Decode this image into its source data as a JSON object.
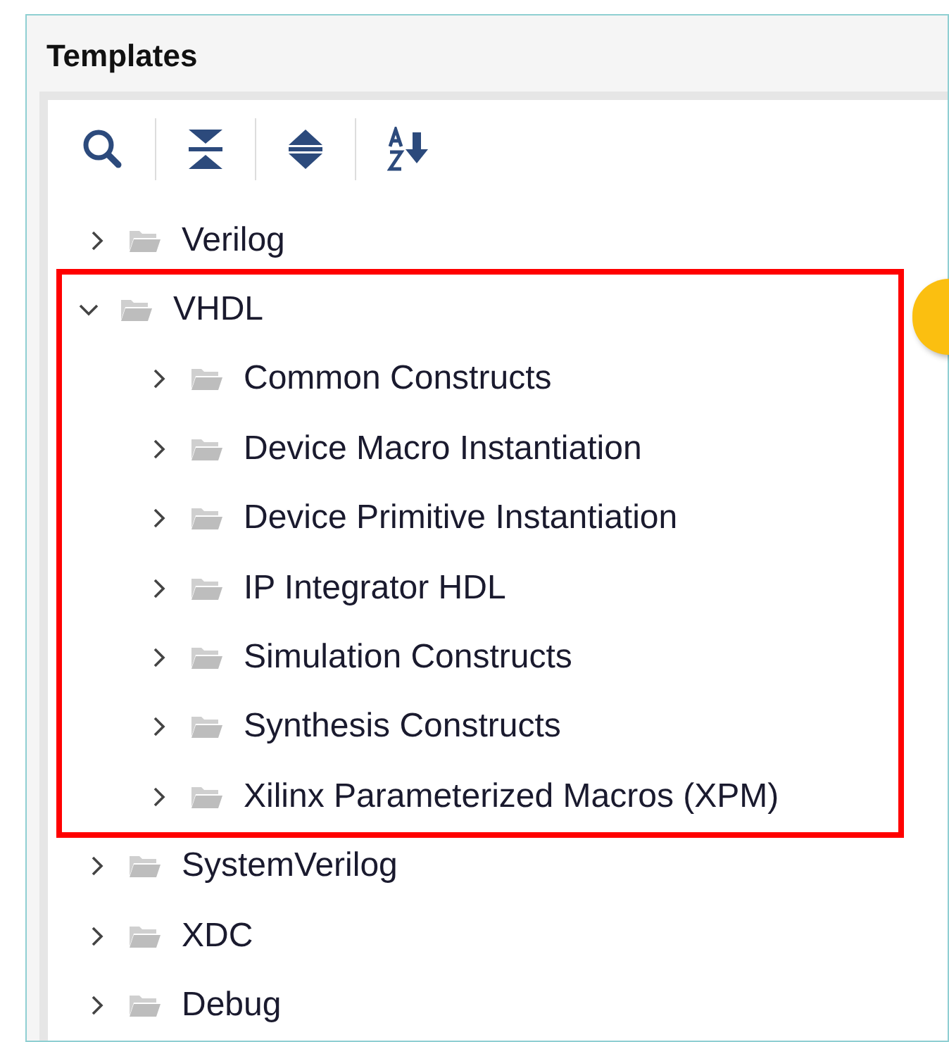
{
  "panel": {
    "title": "Templates"
  },
  "toolbar": [
    {
      "kind": "search"
    },
    {
      "kind": "collapse"
    },
    {
      "kind": "expand"
    },
    {
      "kind": "sort"
    }
  ],
  "tree": [
    {
      "label": "Verilog",
      "expanded": false,
      "highlighted": false
    },
    {
      "label": "VHDL",
      "expanded": true,
      "highlighted": true,
      "children": [
        {
          "label": "Common Constructs",
          "expanded": false,
          "highlighted": false
        },
        {
          "label": "Device Macro Instantiation",
          "expanded": false,
          "highlighted": false
        },
        {
          "label": "Device Primitive Instantiation",
          "expanded": false,
          "highlighted": false
        },
        {
          "label": "IP Integrator HDL",
          "expanded": false,
          "highlighted": false
        },
        {
          "label": "Simulation Constructs",
          "expanded": false,
          "highlighted": false
        },
        {
          "label": "Synthesis Constructs",
          "expanded": false,
          "highlighted": false
        },
        {
          "label": "Xilinx Parameterized Macros (XPM)",
          "expanded": false,
          "highlighted": false
        }
      ]
    },
    {
      "label": "SystemVerilog",
      "expanded": false,
      "highlighted": false
    },
    {
      "label": "XDC",
      "expanded": false,
      "highlighted": false
    },
    {
      "label": "Debug",
      "expanded": false,
      "highlighted": false
    }
  ]
}
